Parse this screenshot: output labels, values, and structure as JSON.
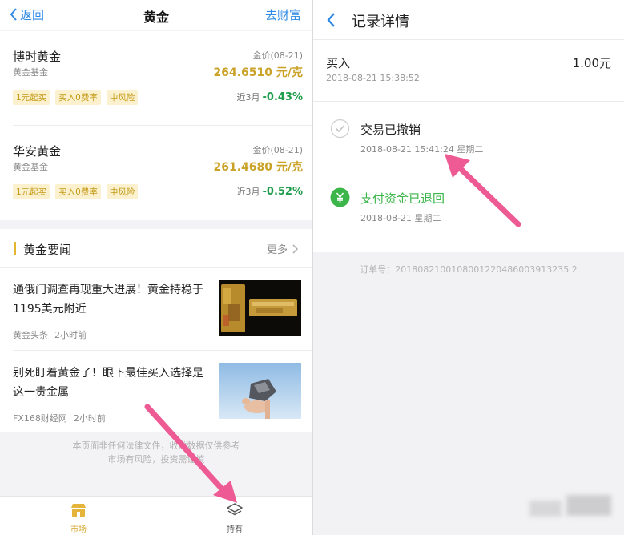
{
  "left": {
    "header": {
      "back": "返回",
      "title": "黄金",
      "right_link": "去财富"
    },
    "funds": [
      {
        "name": "博时黄金",
        "type": "黄金基金",
        "price_label": "金价(08-21)",
        "price": "264.6510 元/克",
        "tags": [
          "1元起买",
          "买入0费率",
          "中风险"
        ],
        "period": "近3月",
        "change": "-0.43%"
      },
      {
        "name": "华安黄金",
        "type": "黄金基金",
        "price_label": "金价(08-21)",
        "price": "261.4680 元/克",
        "tags": [
          "1元起买",
          "买入0费率",
          "中风险"
        ],
        "period": "近3月",
        "change": "-0.52%"
      }
    ],
    "news": {
      "title": "黄金要闻",
      "more": "更多",
      "items": [
        {
          "headline": "通俄门调查再现重大进展！黄金持稳于1195美元附近",
          "source": "黄金头条",
          "time": "2小时前"
        },
        {
          "headline": "别死盯着黄金了！眼下最佳买入选择是这一贵金属",
          "source": "FX168财经网",
          "time": "2小时前"
        }
      ]
    },
    "disclaimer": {
      "line1": "本页面非任何法律文件，收益数据仅供参考",
      "line2": "市场有风险，投资需谨慎"
    },
    "tabbar": {
      "market": "市场",
      "hold": "持有"
    },
    "colors": {
      "accent_blue": "#2f8ae5",
      "gold": "#c9a227",
      "green": "#1f9d4c",
      "tag_bg": "#fbf1cf"
    }
  },
  "right": {
    "header": {
      "title": "记录详情"
    },
    "summary": {
      "label": "买入",
      "amount": "1.00元",
      "time": "2018-08-21 15:38:52"
    },
    "timeline": [
      {
        "title": "交易已撤销",
        "date": "2018-08-21 15:41:24 星期二",
        "icon": "check-circle-icon",
        "state": "done"
      },
      {
        "title": "支付资金已退回",
        "date": "2018-08-21 星期二",
        "icon": "yuan-circle-icon",
        "state": "current"
      }
    ],
    "order": {
      "label": "订单号：",
      "number": "2018082100108001220486003913235 2"
    },
    "colors": {
      "green": "#3cb54a",
      "pink_arrow": "#ee5a93"
    }
  }
}
